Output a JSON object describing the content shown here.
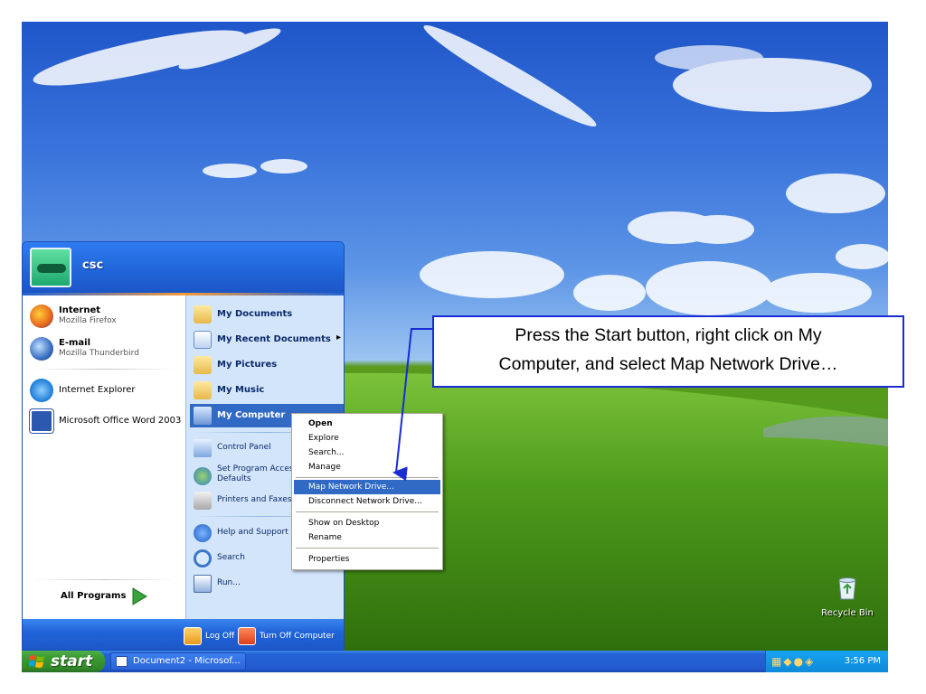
{
  "user": {
    "name": "csc"
  },
  "start_menu": {
    "pinned": [
      {
        "title": "Internet",
        "subtitle": "Mozilla Firefox",
        "icon": "firefox-icon"
      },
      {
        "title": "E-mail",
        "subtitle": "Mozilla Thunderbird",
        "icon": "thunderbird-icon"
      }
    ],
    "recent": [
      {
        "label": "Internet Explorer",
        "icon": "internet-explorer-icon"
      },
      {
        "label": "Microsoft Office Word 2003",
        "icon": "word-icon"
      }
    ],
    "all_programs": "All Programs",
    "right": [
      {
        "label": "My Documents",
        "icon": "my-documents-icon"
      },
      {
        "label": "My Recent Documents",
        "icon": "recent-documents-icon"
      },
      {
        "label": "My Pictures",
        "icon": "my-pictures-icon"
      },
      {
        "label": "My Music",
        "icon": "my-music-icon"
      },
      {
        "label": "My Computer",
        "icon": "my-computer-icon"
      },
      {
        "label": "Control Panel",
        "icon": "control-panel-icon"
      },
      {
        "label": "Set Program Access",
        "label2": "Defaults",
        "icon": "program-access-icon"
      },
      {
        "label": "Printers and Faxes",
        "icon": "printer-icon"
      },
      {
        "label": "Help and Support",
        "icon": "help-icon"
      },
      {
        "label": "Search",
        "icon": "search-icon"
      },
      {
        "label": "Run...",
        "icon": "run-icon"
      }
    ],
    "recent_arrow": "▸",
    "footer": {
      "log_off": "Log Off",
      "turn_off": "Turn Off Computer"
    }
  },
  "context_menu": {
    "items": [
      "Open",
      "Explore",
      "Search...",
      "Manage",
      "Map Network Drive...",
      "Disconnect Network Drive...",
      "Show on Desktop",
      "Rename",
      "Properties"
    ],
    "selected": "Map Network Drive..."
  },
  "callout": {
    "line1": "Press the Start button, right click on My",
    "line2": "Computer, and select Map Network Drive…"
  },
  "desktop": {
    "recycle_bin": "Recycle Bin"
  },
  "taskbar": {
    "start_label": "start",
    "task_button": "Document2 - Microsof...",
    "clock": "3:56 PM"
  },
  "colors": {
    "taskbar_blue": "#225bd0",
    "start_green": "#3c9c33",
    "highlight": "#316ac5",
    "callout_border": "#1a2bd4"
  }
}
